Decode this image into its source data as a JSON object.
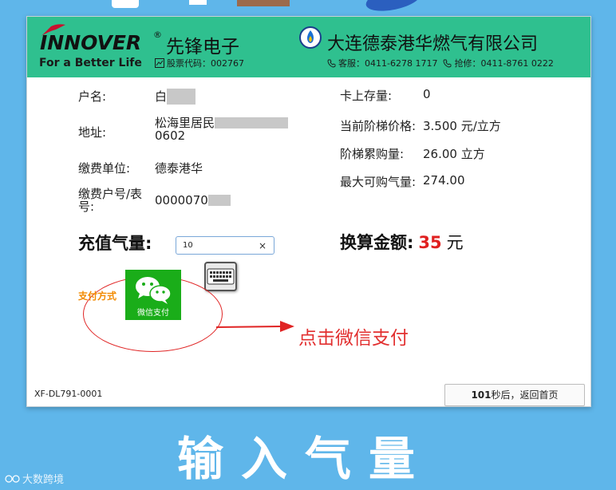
{
  "header": {
    "brand": "INNOVER",
    "brand_reg": "®",
    "brand_cn": "先锋电子",
    "slogan": "For a Better Life",
    "stock": "股票代码：002767",
    "company": "大连德泰港华燃气有限公司",
    "service": "客服：0411-6278 1717",
    "repair": "抢修：0411-8761 0222"
  },
  "account": {
    "name_label": "户名:",
    "name_value": "白",
    "address_label": "地址:",
    "address_line1": "松海里居民",
    "address_line2": "0602",
    "unit_label": "缴费单位:",
    "unit_value": "德泰港华",
    "number_label_1": "缴费户号/表",
    "number_label_2": "号:",
    "number_value": "0000070"
  },
  "card_info": {
    "balance_label": "卡上存量:",
    "balance_value": "0",
    "price_label": "当前阶梯价格:",
    "price_value": "3.500 元/立方",
    "tier_label": "阶梯累购量:",
    "tier_value": "26.00 立方",
    "max_label": "最大可购气量:",
    "max_value": "274.00"
  },
  "recharge": {
    "label": "充值气量:",
    "value": "10",
    "clear": "×"
  },
  "amount": {
    "label": "换算金额:",
    "value": "35",
    "unit": "元"
  },
  "payment": {
    "label": "支付方式",
    "wechat_label": "微信支付",
    "hint": "点击微信支付"
  },
  "footer": {
    "device_code": "XF-DL791-0001",
    "countdown": "101",
    "back_text": "秒后，返回首页"
  },
  "banner": {
    "title": "输入气量",
    "watermark": "大数跨境"
  },
  "colors": {
    "background": "#5fb6ea",
    "header": "#2fc08f",
    "wechat": "#1aad19",
    "accent_red": "#e02020",
    "pay_label": "#f28a00"
  }
}
